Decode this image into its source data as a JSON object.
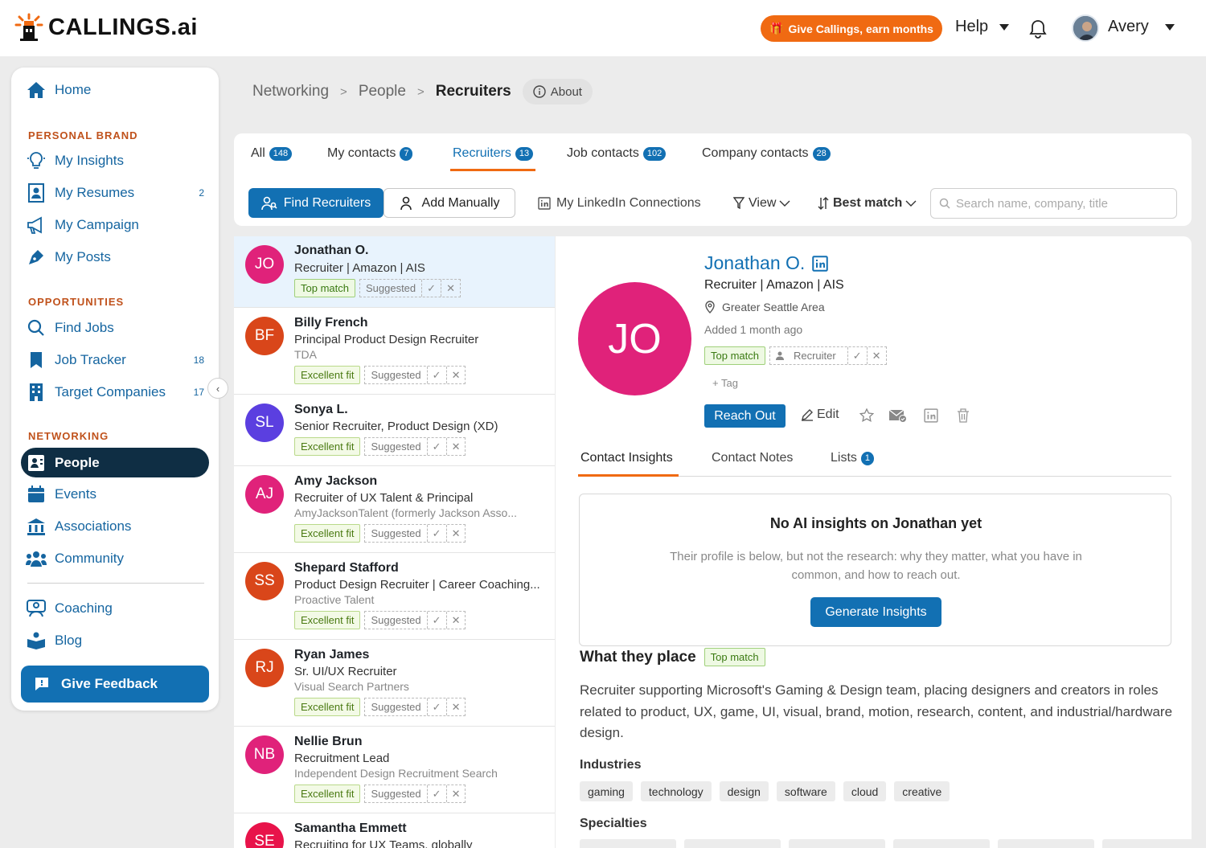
{
  "header": {
    "brand": "CALLINGS",
    "brand_suffix": ".ai",
    "give_label": "Give Callings, earn months",
    "help_label": "Help",
    "user_name": "Avery",
    "accent": "#f06a12",
    "primary": "#1270b3"
  },
  "sidebar": {
    "home": "Home",
    "personal_brand": "PERSONAL BRAND",
    "my_insights": "My Insights",
    "my_resumes": "My Resumes",
    "my_resumes_count": "2",
    "my_campaign": "My Campaign",
    "my_posts": "My Posts",
    "opportunities": "OPPORTUNITIES",
    "find_jobs": "Find Jobs",
    "job_tracker": "Job Tracker",
    "job_tracker_count": "18",
    "target_companies": "Target Companies",
    "target_companies_count": "17",
    "networking": "NETWORKING",
    "people": "People",
    "events": "Events",
    "associations": "Associations",
    "community": "Community",
    "coaching": "Coaching",
    "blog": "Blog",
    "feedback": "Give Feedback"
  },
  "breadcrumb": {
    "networking": "Networking",
    "people": "People",
    "current": "Recruiters",
    "about": "About"
  },
  "tabs": [
    {
      "label": "All",
      "count": "148"
    },
    {
      "label": "My contacts",
      "count": "7"
    },
    {
      "label": "Recruiters",
      "count": "13"
    },
    {
      "label": "Job contacts",
      "count": "102"
    },
    {
      "label": "Company contacts",
      "count": "28"
    }
  ],
  "toolbar": {
    "find": "Find Recruiters",
    "add": "Add Manually",
    "linkedin": "My LinkedIn Connections",
    "view": "View",
    "sort": "Best match",
    "search_placeholder": "Search name, company, title"
  },
  "contacts": [
    {
      "initials": "JO",
      "color": "#e0227a",
      "name": "Jonathan O.",
      "title": "Recruiter | Amazon | AIS",
      "company": "",
      "fit": "Top match",
      "status": "Suggested"
    },
    {
      "initials": "BF",
      "color": "#d9461a",
      "name": "Billy French",
      "title": "Principal Product Design Recruiter",
      "company": "TDA",
      "fit": "Excellent fit",
      "status": "Suggested"
    },
    {
      "initials": "SL",
      "color": "#5b3fe0",
      "name": "Sonya L.",
      "title": "Senior Recruiter, Product Design (XD)",
      "company": "",
      "fit": "Excellent fit",
      "status": "Suggested"
    },
    {
      "initials": "AJ",
      "color": "#e0227a",
      "name": "Amy Jackson",
      "title": "Recruiter of UX Talent & Principal",
      "company": "AmyJacksonTalent (formerly Jackson Asso...",
      "fit": "Excellent fit",
      "status": "Suggested"
    },
    {
      "initials": "SS",
      "color": "#d9461a",
      "name": "Shepard Stafford",
      "title": "Product Design Recruiter | Career Coaching...",
      "company": "Proactive Talent",
      "fit": "Excellent fit",
      "status": "Suggested"
    },
    {
      "initials": "RJ",
      "color": "#d9461a",
      "name": "Ryan James",
      "title": "Sr. UI/UX Recruiter",
      "company": "Visual Search Partners",
      "fit": "Excellent fit",
      "status": "Suggested"
    },
    {
      "initials": "NB",
      "color": "#e0227a",
      "name": "Nellie Brun",
      "title": "Recruitment Lead",
      "company": "Independent Design Recruitment Search",
      "fit": "Excellent fit",
      "status": "Suggested"
    },
    {
      "initials": "SE",
      "color": "#e8134a",
      "name": "Samantha Emmett",
      "title": "Recruiting for UX Teams, globally",
      "company": "",
      "fit": "",
      "status": ""
    }
  ],
  "detail": {
    "initials": "JO",
    "name": "Jonathan O.",
    "title": "Recruiter | Amazon | AIS",
    "location": "Greater Seattle Area",
    "added": "Added 1 month ago",
    "fit": "Top match",
    "role_tag": "Recruiter",
    "add_tag": "+ Tag",
    "reach_out": "Reach Out",
    "edit": "Edit",
    "tabs": [
      "Contact Insights",
      "Contact Notes",
      "Lists"
    ],
    "lists_count": "1",
    "no_insights_title": "No AI insights on Jonathan yet",
    "no_insights_text": "Their profile is below, but not the research: why they matter, what you have in common, and how to reach out.",
    "generate": "Generate Insights",
    "wtp_title": "What they place",
    "wtp_badge": "Top match",
    "wtp_desc": "Recruiter supporting Microsoft's Gaming & Design team, placing designers and creators in roles related to product, UX, game, UI, visual, brand, motion, research, content, and industrial/hardware design.",
    "industries_title": "Industries",
    "industries": [
      "gaming",
      "technology",
      "design",
      "software",
      "cloud",
      "creative"
    ],
    "specialties_title": "Specialties"
  }
}
